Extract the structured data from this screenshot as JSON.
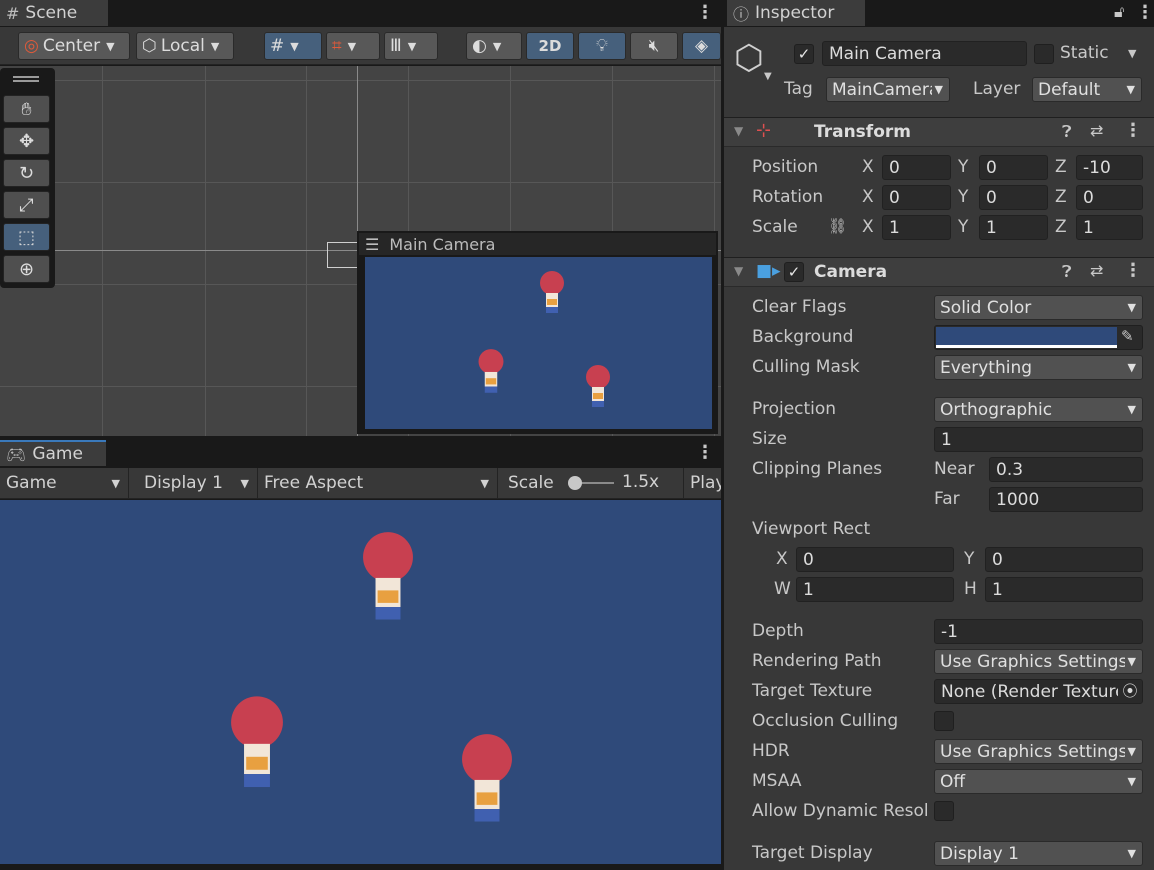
{
  "scene": {
    "tab_label": "Scene",
    "pivot_label": "Center",
    "space_label": "Local",
    "mode_2d_label": "2D",
    "preview_title": "Main Camera"
  },
  "game": {
    "tab_label": "Game",
    "view_dropdown": "Game",
    "display_dropdown": "Display 1",
    "aspect_dropdown": "Free Aspect",
    "scale_label": "Scale",
    "scale_value": "1.5x",
    "play_label": "Play"
  },
  "inspector": {
    "tab_label": "Inspector",
    "object_name": "Main Camera",
    "static_label": "Static",
    "tag_label": "Tag",
    "tag_value": "MainCamera",
    "layer_label": "Layer",
    "layer_value": "Default",
    "transform": {
      "title": "Transform",
      "position_label": "Position",
      "rotation_label": "Rotation",
      "scale_label": "Scale",
      "axis_x": "X",
      "axis_y": "Y",
      "axis_z": "Z",
      "position": {
        "x": "0",
        "y": "0",
        "z": "-10"
      },
      "rotation": {
        "x": "0",
        "y": "0",
        "z": "0"
      },
      "scale": {
        "x": "1",
        "y": "1",
        "z": "1"
      }
    },
    "camera": {
      "title": "Camera",
      "clear_flags_label": "Clear Flags",
      "clear_flags_value": "Solid Color",
      "background_label": "Background",
      "background_color": "#2f4a7a",
      "culling_mask_label": "Culling Mask",
      "culling_mask_value": "Everything",
      "projection_label": "Projection",
      "projection_value": "Orthographic",
      "size_label": "Size",
      "size_value": "1",
      "clipping_label": "Clipping Planes",
      "near_label": "Near",
      "near_value": "0.3",
      "far_label": "Far",
      "far_value": "1000",
      "viewport_label": "Viewport Rect",
      "vp_x_label": "X",
      "vp_x": "0",
      "vp_y_label": "Y",
      "vp_y": "0",
      "vp_w_label": "W",
      "vp_w": "1",
      "vp_h_label": "H",
      "vp_h": "1",
      "depth_label": "Depth",
      "depth_value": "-1",
      "rendering_path_label": "Rendering Path",
      "rendering_path_value": "Use Graphics Settings",
      "target_texture_label": "Target Texture",
      "target_texture_value": "None (Render Texture)",
      "occlusion_label": "Occlusion Culling",
      "hdr_label": "HDR",
      "hdr_value": "Use Graphics Settings",
      "msaa_label": "MSAA",
      "msaa_value": "Off",
      "dynamic_res_label": "Allow Dynamic Resolution",
      "target_display_label": "Target Display",
      "target_display_value": "Display 1"
    }
  },
  "colors": {
    "panel": "#383838",
    "scene_bg": "#444444",
    "camera_bg": "#2f4a7a",
    "selected_tool": "#46607c"
  },
  "icons": {
    "scene_tab": "hash-icon",
    "game_tab": "gamepad-icon",
    "inspector_tab": "info-icon",
    "tools": [
      "hand-icon",
      "move-icon",
      "rotate-icon",
      "scale-icon",
      "rect-icon",
      "transform-icon"
    ]
  }
}
